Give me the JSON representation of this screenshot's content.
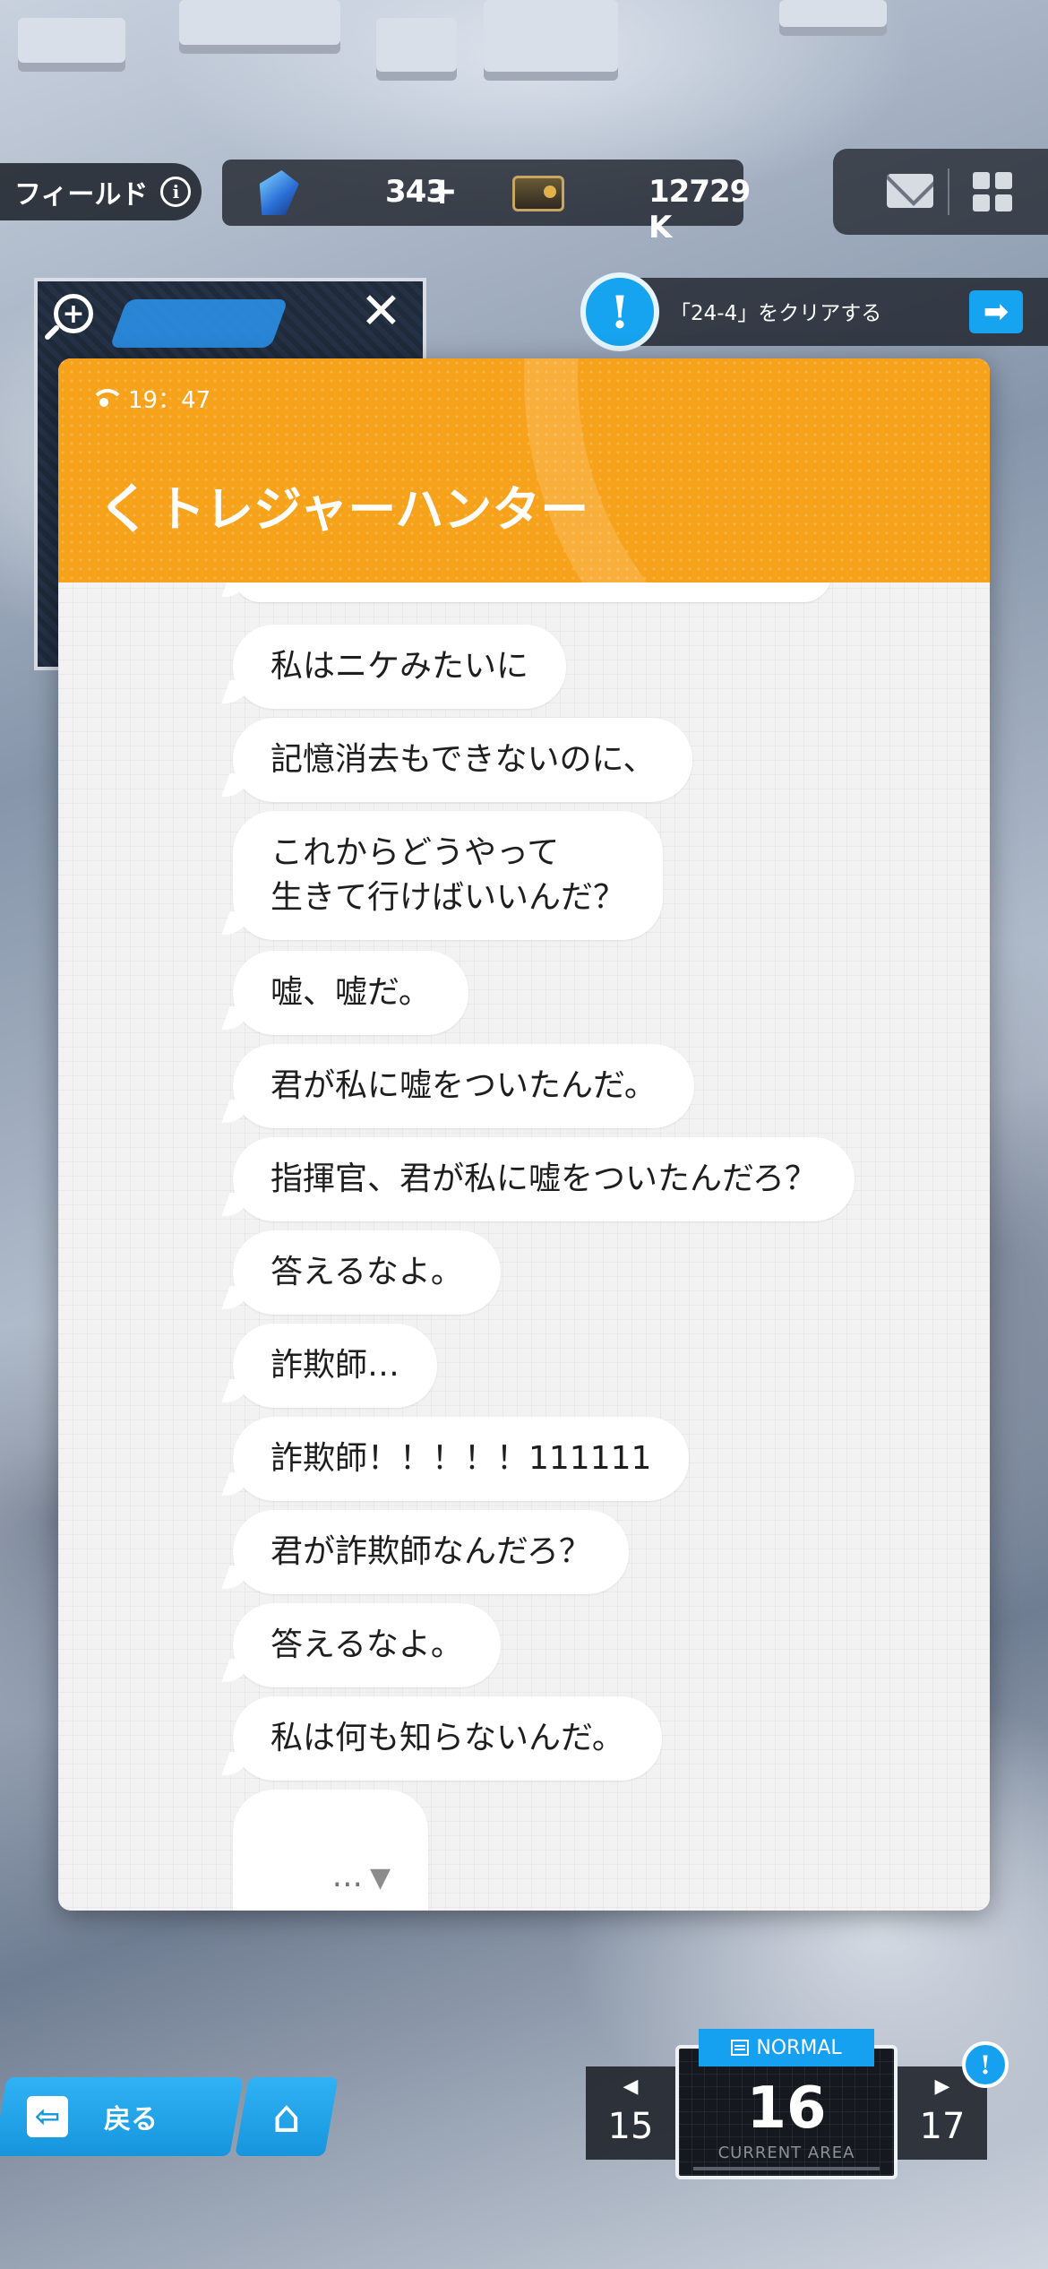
{
  "hud": {
    "field_label": "フィールド",
    "info_icon": "i",
    "gems": "343",
    "plus": "+",
    "gold": "12729 K"
  },
  "mission": {
    "alert": "!",
    "text": "「24-4」をクリアする",
    "go_arrow": "➡"
  },
  "minimap": {
    "zoom_icon": "+",
    "close_icon": "✕"
  },
  "chat": {
    "status_time": "19：47",
    "back_chevron": "く",
    "title": "トレジャーハンター",
    "messages": [
      "私はニケみたいに",
      "記憶消去もできないのに、",
      "これからどうやって\n生きて行けばいいんだ？",
      "嘘、嘘だ。",
      "君が私に嘘をついたんだ。",
      "指揮官、君が私に嘘をついたんだろ？",
      "答えるなよ。",
      "詐欺師…",
      "詐欺師！！！！！111111",
      "君が詐欺師なんだろ？",
      "答えるなよ。",
      "私は何も知らないんだ。"
    ],
    "typing_dots": "...",
    "typing_arrow": "▼"
  },
  "bottom": {
    "back_label": "戻る",
    "exit_icon": "⇦",
    "home_icon": "⌂",
    "difficulty": "NORMAL",
    "prev_area": "15",
    "current_area": "16",
    "current_caption": "CURRENT AREA",
    "next_area": "17",
    "alert": "!"
  },
  "colors": {
    "header_orange": "#f7a21b",
    "accent_blue": "#15a0f0"
  }
}
